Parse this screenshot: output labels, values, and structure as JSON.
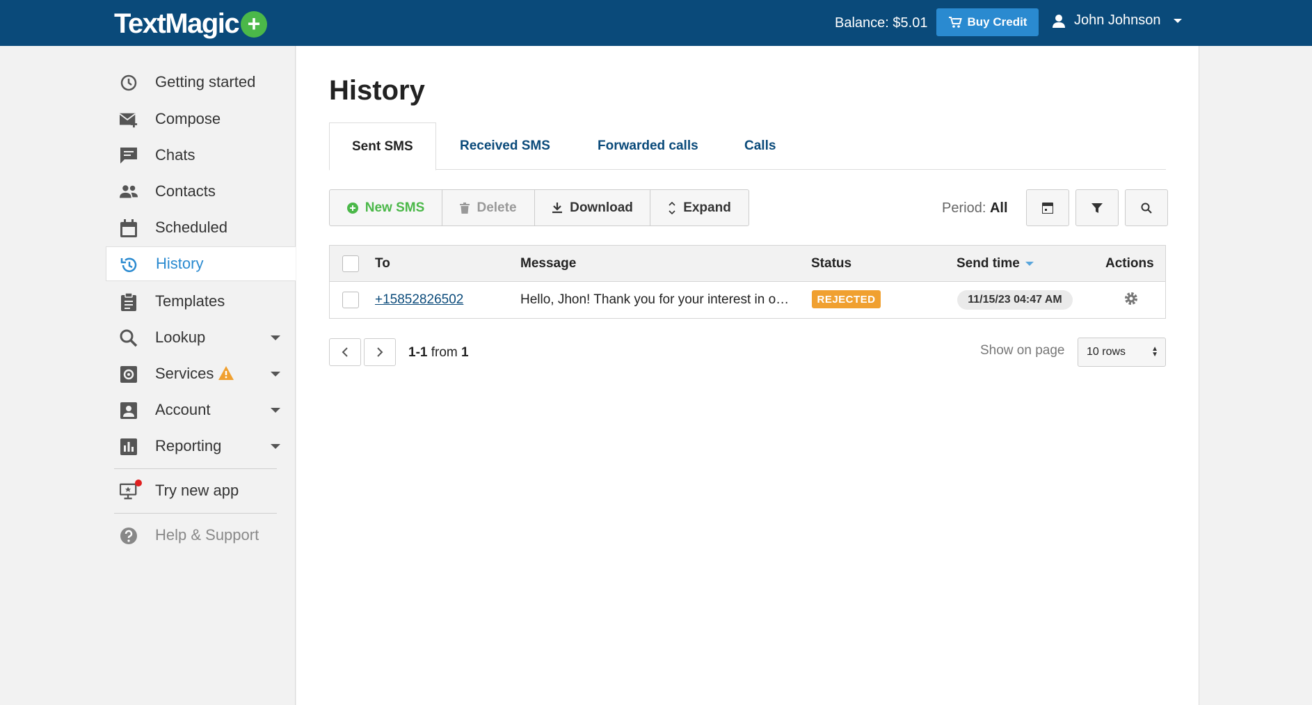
{
  "app": {
    "logo": "TextMagic",
    "balance": "Balance: $5.01",
    "buy_credit": "Buy Credit",
    "user_name": "John Johnson"
  },
  "sidebar": {
    "items": [
      {
        "label": "Getting started",
        "icon": "clock-rocket-icon"
      },
      {
        "label": "Compose",
        "icon": "envelope-plus-icon"
      },
      {
        "label": "Chats",
        "icon": "chat-icon"
      },
      {
        "label": "Contacts",
        "icon": "users-icon"
      },
      {
        "label": "Scheduled",
        "icon": "calendar-icon"
      },
      {
        "label": "History",
        "icon": "history-icon",
        "active": true
      },
      {
        "label": "Templates",
        "icon": "clipboard-icon"
      },
      {
        "label": "Lookup",
        "icon": "search-icon",
        "expandable": true
      },
      {
        "label": "Services",
        "icon": "gear-box-icon",
        "expandable": true,
        "warning": true
      },
      {
        "label": "Account",
        "icon": "account-icon",
        "expandable": true
      },
      {
        "label": "Reporting",
        "icon": "bar-chart-icon",
        "expandable": true
      }
    ],
    "try_new_app": "Try new app",
    "help": "Help & Support"
  },
  "main": {
    "title": "History",
    "tabs": [
      {
        "label": "Sent SMS",
        "active": true
      },
      {
        "label": "Received SMS"
      },
      {
        "label": "Forwarded calls"
      },
      {
        "label": "Calls"
      }
    ],
    "toolbar": {
      "new_sms": "New SMS",
      "delete": "Delete",
      "download": "Download",
      "expand": "Expand",
      "period_label": "Period:",
      "period_value": "All"
    },
    "table": {
      "columns": [
        "To",
        "Message",
        "Status",
        "Send time",
        "Actions"
      ],
      "rows": [
        {
          "to": "+15852826502",
          "message": "Hello, Jhon! Thank you for your interest in o…",
          "status": "REJECTED",
          "send_time": "11/15/23 04:47 AM"
        }
      ]
    },
    "pagination": {
      "range": "1-1",
      "from_label": "from",
      "total": "1",
      "show_on_page": "Show on page",
      "rows_option": "10 rows"
    }
  },
  "colors": {
    "topbar": "#0a4a7a",
    "accent": "#2a8ad0",
    "green": "#4bb849",
    "rejected": "#f0a030"
  }
}
